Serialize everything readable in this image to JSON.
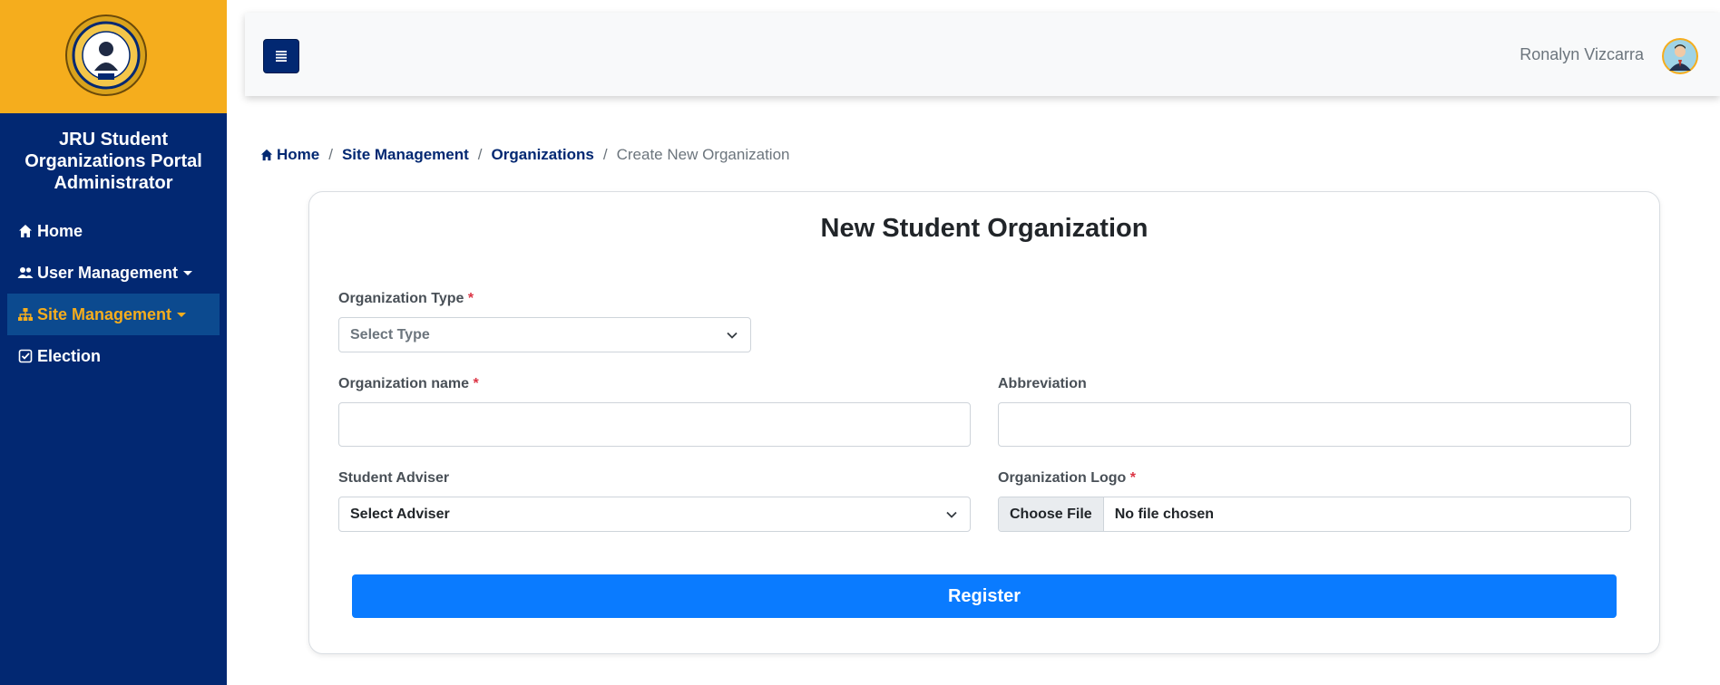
{
  "sidebar": {
    "title": "JRU Student Organizations Portal Administrator",
    "items": [
      {
        "label": "Home",
        "icon": "home-icon",
        "active": false,
        "dropdown": false
      },
      {
        "label": "User Management",
        "icon": "users-icon",
        "active": false,
        "dropdown": true
      },
      {
        "label": "Site Management",
        "icon": "sitemap-icon",
        "active": true,
        "dropdown": true
      },
      {
        "label": "Election",
        "icon": "check-square-icon",
        "active": false,
        "dropdown": false
      }
    ]
  },
  "topbar": {
    "user_name": "Ronalyn Vizcarra"
  },
  "breadcrumb": {
    "items": [
      "Home",
      "Site Management",
      "Organizations"
    ],
    "current": "Create New Organization"
  },
  "form": {
    "title": "New Student Organization",
    "org_type": {
      "label": "Organization Type",
      "required_mark": "*",
      "value": "Select Type"
    },
    "org_name": {
      "label": "Organization name",
      "required_mark": "*",
      "value": ""
    },
    "abbreviation": {
      "label": "Abbreviation",
      "value": ""
    },
    "adviser": {
      "label": "Student Adviser",
      "value": "Select Adviser"
    },
    "logo": {
      "label": "Organization Logo",
      "required_mark": "*",
      "button": "Choose File",
      "status": "No file chosen"
    },
    "submit": "Register"
  },
  "colors": {
    "sidebar_bg": "#022872",
    "accent_gold": "#f5ad1d",
    "primary_button": "#0a7bff",
    "required": "#dc3545"
  }
}
